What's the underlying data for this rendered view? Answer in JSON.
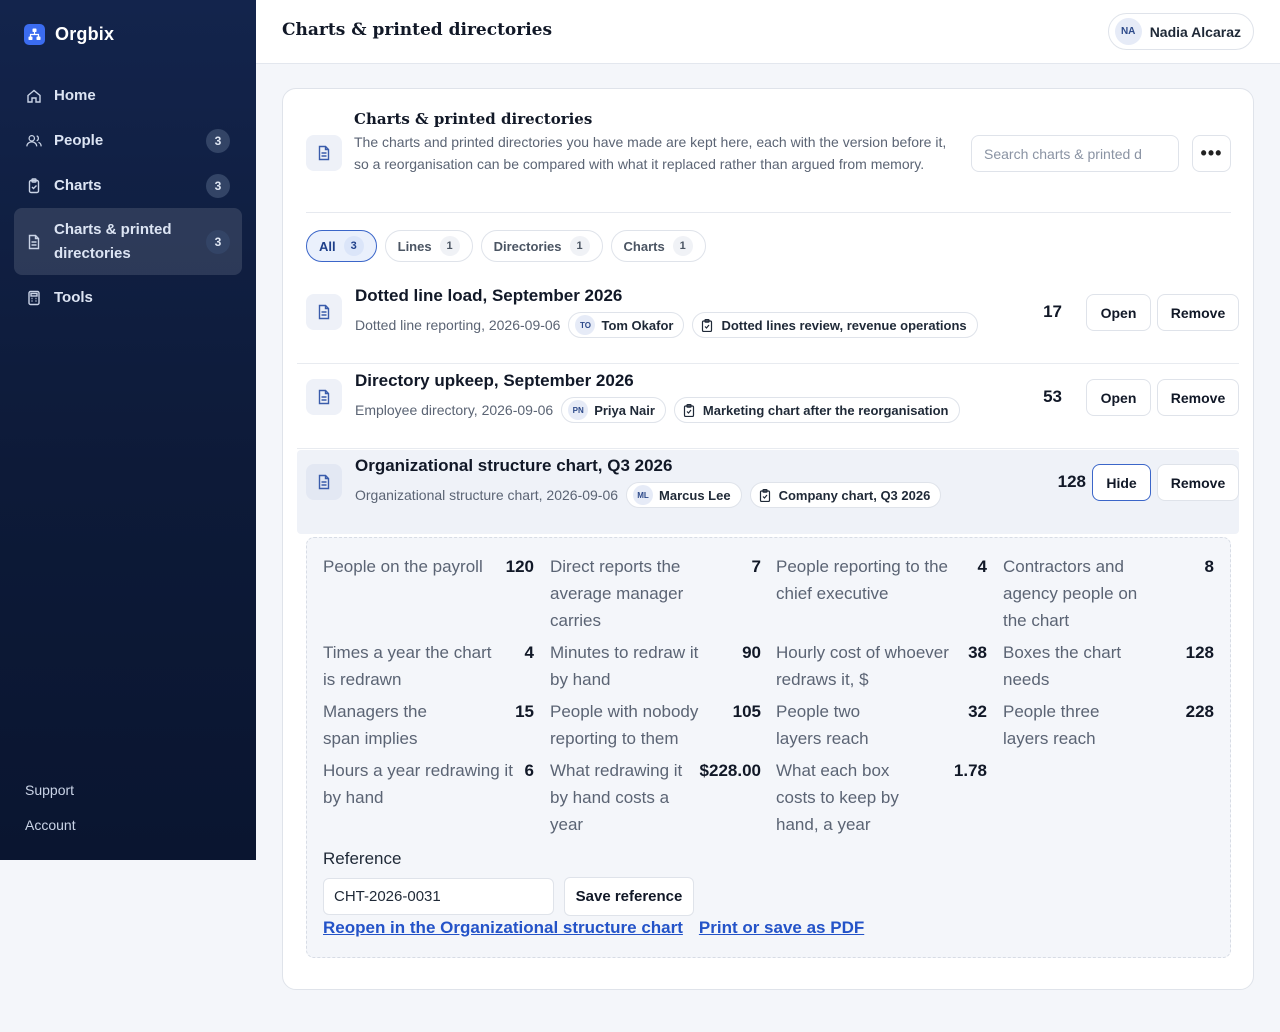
{
  "brand": {
    "name": "Orgbix"
  },
  "sidebar": {
    "items": [
      {
        "label": "Home",
        "icon": "home-icon"
      },
      {
        "label": "People",
        "icon": "people-icon",
        "badge": "3"
      },
      {
        "label": "Charts",
        "icon": "clipboard-icon",
        "badge": "3"
      },
      {
        "label": "Charts & printed directories",
        "icon": "document-icon",
        "badge": "3",
        "active": true
      },
      {
        "label": "Tools",
        "icon": "calculator-icon"
      }
    ],
    "footer": {
      "support": "Support",
      "account": "Account"
    }
  },
  "header": {
    "title": "Charts & printed directories",
    "user": {
      "initials": "NA",
      "name": "Nadia Alcaraz"
    }
  },
  "card": {
    "title": "Charts & printed directories",
    "description": "The charts and printed directories you have made are kept here, each with the version before it, so a reorganisation can be compared with what it replaced rather than argued from memory.",
    "search_placeholder": "Search charts & printed d",
    "more_label": "•••"
  },
  "filters": [
    {
      "label": "All",
      "count": "3",
      "active": true
    },
    {
      "label": "Lines",
      "count": "1"
    },
    {
      "label": "Directories",
      "count": "1"
    },
    {
      "label": "Charts",
      "count": "1"
    }
  ],
  "rows": [
    {
      "title": "Dotted line load, September 2026",
      "meta": "Dotted line reporting, 2026-09-06",
      "person_initials": "TO",
      "person": "Tom Okafor",
      "source": "Dotted lines review, revenue operations",
      "count": "17",
      "primary_action": "Open",
      "remove": "Remove"
    },
    {
      "title": "Directory upkeep, September 2026",
      "meta": "Employee directory, 2026-09-06",
      "person_initials": "PN",
      "person": "Priya Nair",
      "source": "Marketing chart after the reorganisation",
      "count": "53",
      "primary_action": "Open",
      "remove": "Remove"
    },
    {
      "title": "Organizational structure chart, Q3 2026",
      "meta": "Organizational structure chart, 2026-09-06",
      "person_initials": "ML",
      "person": "Marcus Lee",
      "source": "Company chart, Q3 2026",
      "count": "128",
      "primary_action": "Hide",
      "remove": "Remove"
    }
  ],
  "details": {
    "stats": [
      {
        "label": "People on the payroll",
        "value": "120"
      },
      {
        "label": "Direct reports the average manager carries",
        "value": "7"
      },
      {
        "label": "People reporting to the chief executive",
        "value": "4"
      },
      {
        "label": "Contractors and agency people on the chart",
        "value": "8"
      },
      {
        "label": "Times a year the chart is redrawn",
        "value": "4"
      },
      {
        "label": "Minutes to redraw it by hand",
        "value": "90"
      },
      {
        "label": "Hourly cost of whoever redraws it, $",
        "value": "38"
      },
      {
        "label": "Boxes the chart needs",
        "value": "128"
      },
      {
        "label": "Managers the span implies",
        "value": "15"
      },
      {
        "label": "People with nobody reporting to them",
        "value": "105"
      },
      {
        "label": "People two layers reach",
        "value": "32"
      },
      {
        "label": "People three layers reach",
        "value": "228"
      },
      {
        "label": "Hours a year redrawing it by hand",
        "value": "6"
      },
      {
        "label": "What redrawing it by hand costs a year",
        "value": "$228.00"
      },
      {
        "label": "What each box costs to keep by hand, a year",
        "value": "1.78"
      }
    ],
    "reference_label": "Reference",
    "reference_value": "CHT-2026-0031",
    "save_reference": "Save reference",
    "reopen_link": "Reopen in the Organizational structure chart",
    "print_link": "Print or save as PDF"
  }
}
